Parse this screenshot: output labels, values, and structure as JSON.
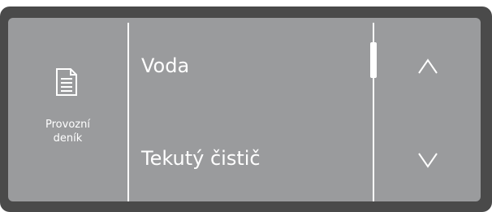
{
  "left_panel": {
    "icon": "document-icon",
    "label_line1": "Provozní",
    "label_line2": "deník"
  },
  "menu": {
    "items": [
      {
        "label": "Voda"
      },
      {
        "label": "Tekutý čistič"
      }
    ]
  },
  "scroll": {
    "position_fraction": 0.0,
    "visible_fraction": 0.2
  },
  "nav": {
    "up_icon": "chevron-up-icon",
    "down_icon": "chevron-down-icon"
  },
  "colors": {
    "screen_background": "#9a9b9d",
    "bezel": "#4a4a4a",
    "foreground": "#ffffff"
  }
}
